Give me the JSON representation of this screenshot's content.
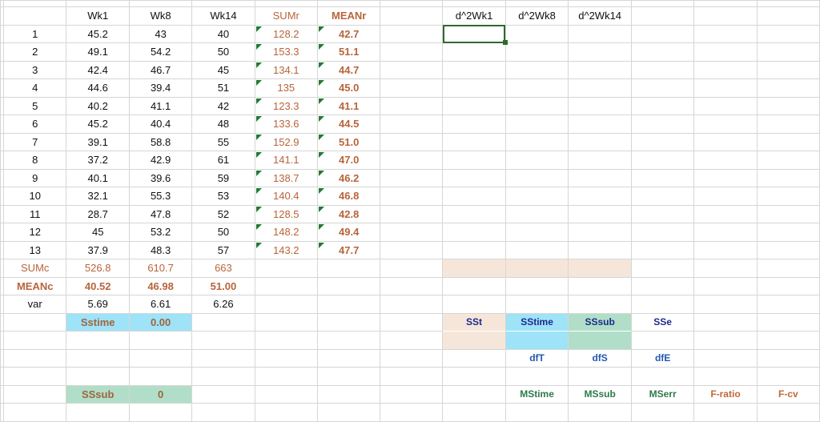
{
  "headers": {
    "wk1": "Wk1",
    "wk8": "Wk8",
    "wk14": "Wk14",
    "sumr": "SUMr",
    "meanr": "MEANr",
    "d2wk1": "d^2Wk1",
    "d2wk8": "d^2Wk8",
    "d2wk14": "d^2Wk14"
  },
  "rows": [
    {
      "id": "1",
      "wk1": "45.2",
      "wk8": "43",
      "wk14": "40",
      "sumr": "128.2",
      "meanr": "42.7"
    },
    {
      "id": "2",
      "wk1": "49.1",
      "wk8": "54.2",
      "wk14": "50",
      "sumr": "153.3",
      "meanr": "51.1"
    },
    {
      "id": "3",
      "wk1": "42.4",
      "wk8": "46.7",
      "wk14": "45",
      "sumr": "134.1",
      "meanr": "44.7"
    },
    {
      "id": "4",
      "wk1": "44.6",
      "wk8": "39.4",
      "wk14": "51",
      "sumr": "135",
      "meanr": "45.0"
    },
    {
      "id": "5",
      "wk1": "40.2",
      "wk8": "41.1",
      "wk14": "42",
      "sumr": "123.3",
      "meanr": "41.1"
    },
    {
      "id": "6",
      "wk1": "45.2",
      "wk8": "40.4",
      "wk14": "48",
      "sumr": "133.6",
      "meanr": "44.5"
    },
    {
      "id": "7",
      "wk1": "39.1",
      "wk8": "58.8",
      "wk14": "55",
      "sumr": "152.9",
      "meanr": "51.0"
    },
    {
      "id": "8",
      "wk1": "37.2",
      "wk8": "42.9",
      "wk14": "61",
      "sumr": "141.1",
      "meanr": "47.0"
    },
    {
      "id": "9",
      "wk1": "40.1",
      "wk8": "39.6",
      "wk14": "59",
      "sumr": "138.7",
      "meanr": "46.2"
    },
    {
      "id": "10",
      "wk1": "32.1",
      "wk8": "55.3",
      "wk14": "53",
      "sumr": "140.4",
      "meanr": "46.8"
    },
    {
      "id": "11",
      "wk1": "28.7",
      "wk8": "47.8",
      "wk14": "52",
      "sumr": "128.5",
      "meanr": "42.8"
    },
    {
      "id": "12",
      "wk1": "45",
      "wk8": "53.2",
      "wk14": "50",
      "sumr": "148.2",
      "meanr": "49.4"
    },
    {
      "id": "13",
      "wk1": "37.9",
      "wk8": "48.3",
      "wk14": "57",
      "sumr": "143.2",
      "meanr": "47.7"
    }
  ],
  "sumc": {
    "label": "SUMc",
    "wk1": "526.8",
    "wk8": "610.7",
    "wk14": "663"
  },
  "meanc": {
    "label": "MEANc",
    "wk1": "40.52",
    "wk8": "46.98",
    "wk14": "51.00"
  },
  "var": {
    "label": "var",
    "wk1": "5.69",
    "wk8": "6.61",
    "wk14": "6.26"
  },
  "sstime": {
    "label": "Sstime",
    "value": "0.00"
  },
  "sssub": {
    "label": "SSsub",
    "value": "0"
  },
  "anova": {
    "sst": "SSt",
    "sstime": "SStime",
    "sssub": "SSsub",
    "sse": "SSe",
    "dft": "dfT",
    "dfs": "dfS",
    "dfe": "dfE",
    "mstime": "MStime",
    "mssub": "MSsub",
    "mserr": "MSerr",
    "fratio": "F-ratio",
    "fcv": "F-cv"
  }
}
